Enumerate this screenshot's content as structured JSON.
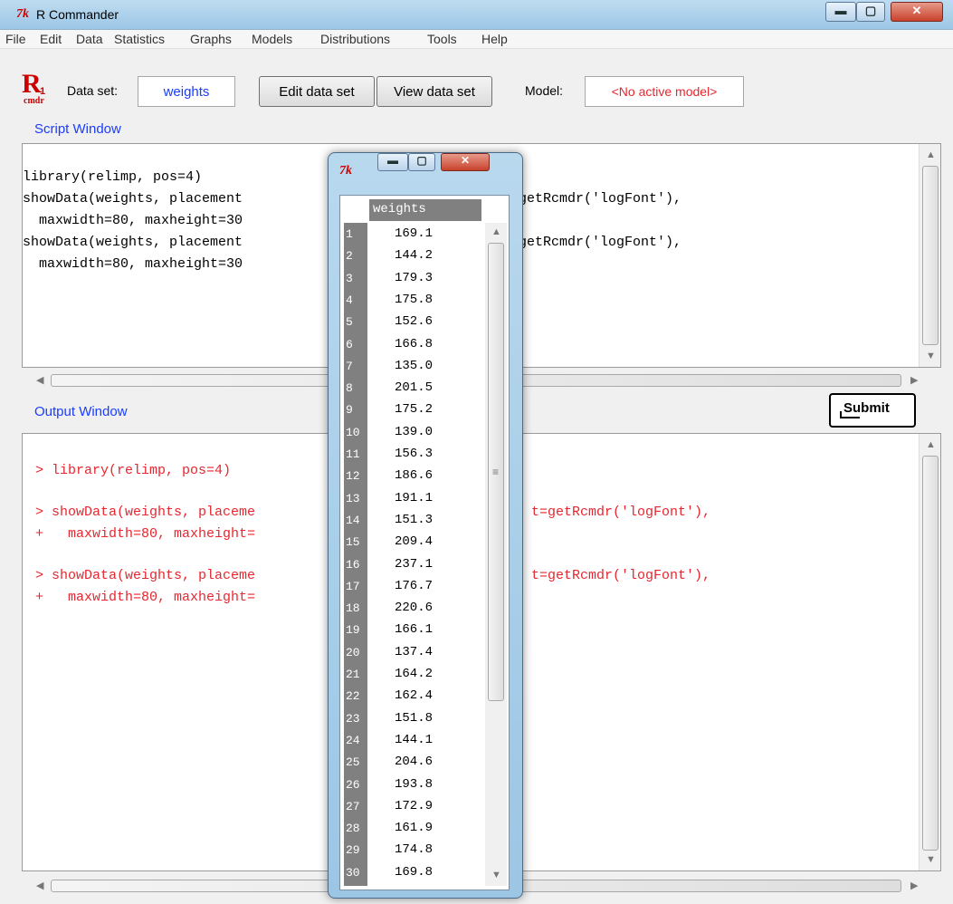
{
  "app": {
    "title": "R Commander",
    "logo_text": "7k"
  },
  "window_controls": {
    "minimize_glyph": "▬",
    "maximize_glyph": "▢",
    "close_glyph": "✕"
  },
  "menu": [
    "File",
    "Edit",
    "Data",
    "Statistics",
    "Graphs",
    "Models",
    "Distributions",
    "Tools",
    "Help"
  ],
  "toolbar": {
    "dataset_label": "Data set:",
    "dataset_value": "weights",
    "edit_button": "Edit data set",
    "view_button": "View data set",
    "model_label": "Model:",
    "model_value": "<No active model>"
  },
  "script_window": {
    "label": "Script Window",
    "lines": [
      "library(relimp, pos=4)",
      "showData(weights, placement",
      "  maxwidth=80, maxheight=30",
      "showData(weights, placement",
      "  maxwidth=80, maxheight=30"
    ],
    "right_fragments": [
      "getRcmdr('logFont'),",
      "getRcmdr('logFont'),"
    ]
  },
  "submit_button": "Submit",
  "output_window": {
    "label": "Output Window",
    "color": "#e8262f",
    "lines": [
      "> library(relimp, pos=4)",
      "> showData(weights, placeme",
      "+   maxwidth=80, maxheight=",
      "> showData(weights, placeme",
      "+   maxwidth=80, maxheight="
    ],
    "right_fragments": [
      "t=getRcmdr('logFont'),",
      "t=getRcmdr('logFont'),"
    ]
  },
  "popup": {
    "logo_text": "7k",
    "column_header": "weights",
    "row_numbers": [
      "1",
      "2",
      "3",
      "4",
      "5",
      "6",
      "7",
      "8",
      "9",
      "10",
      "11",
      "12",
      "13",
      "14",
      "15",
      "16",
      "17",
      "18",
      "19",
      "20",
      "21",
      "22",
      "23",
      "24",
      "25",
      "26",
      "27",
      "28",
      "29",
      "30"
    ],
    "values": [
      "169.1",
      "144.2",
      "179.3",
      "175.8",
      "152.6",
      "166.8",
      "135.0",
      "201.5",
      "175.2",
      "139.0",
      "156.3",
      "186.6",
      "191.1",
      "151.3",
      "209.4",
      "237.1",
      "176.7",
      "220.6",
      "166.1",
      "137.4",
      "164.2",
      "162.4",
      "151.8",
      "144.1",
      "204.6",
      "193.8",
      "172.9",
      "161.9",
      "174.8",
      "169.8"
    ]
  },
  "colors": {
    "title_logo": "#cc0000",
    "section_label": "#1a3cff",
    "model_value": "#e8262f"
  }
}
